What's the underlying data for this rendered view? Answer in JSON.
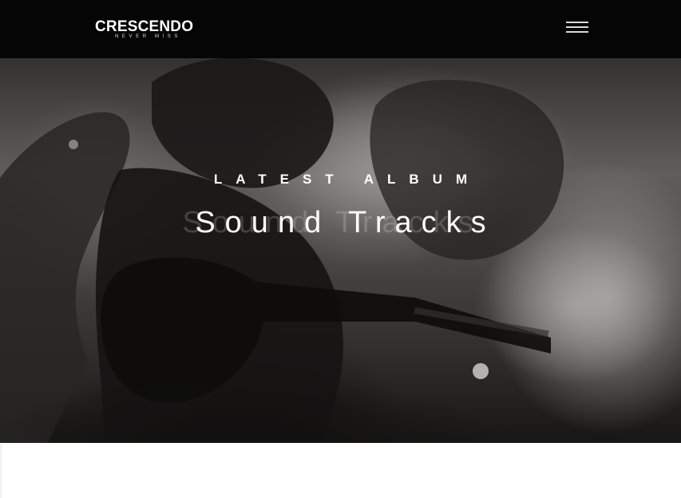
{
  "header": {
    "logo_title": "CRESCENDO",
    "logo_tagline": "NEVER MISS",
    "menu_icon": "hamburger-menu-icon"
  },
  "hero": {
    "kicker": "LATEST ALBUM",
    "title": "Sound Tracks",
    "image": "concert-guitarist-photo"
  },
  "colors": {
    "header_bg": "#050505",
    "text": "#ffffff",
    "menu_bars": "#d8d8d8"
  }
}
